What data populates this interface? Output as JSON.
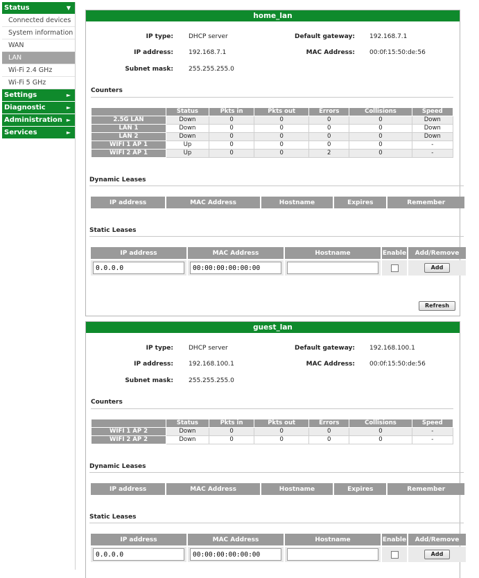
{
  "sidebar": {
    "groups": [
      {
        "label": "Status",
        "arrow": "▼",
        "items": [
          "Connected devices",
          "System information",
          "WAN",
          "LAN",
          "Wi-Fi 2.4 GHz",
          "Wi-Fi 5 GHz"
        ]
      },
      {
        "label": "Settings",
        "arrow": "►"
      },
      {
        "label": "Diagnostic",
        "arrow": "►"
      },
      {
        "label": "Administration",
        "arrow": "►"
      },
      {
        "label": "Services",
        "arrow": "►"
      }
    ],
    "active_item": "LAN"
  },
  "labels": {
    "ip_type": "IP type:",
    "ip_address": "IP address:",
    "subnet_mask": "Subnet mask:",
    "default_gateway": "Default gateway:",
    "mac_address": "MAC Address:",
    "counters": "Counters",
    "dynamic_leases": "Dynamic Leases",
    "static_leases": "Static Leases",
    "refresh": "Refresh",
    "add": "Add"
  },
  "counter_headers": [
    "Status",
    "Pkts in",
    "Pkts out",
    "Errors",
    "Collisions",
    "Speed"
  ],
  "dynamic_headers": [
    "IP address",
    "MAC Address",
    "Hostname",
    "Expires",
    "Remember"
  ],
  "static_headers": [
    "IP address",
    "MAC Address",
    "Hostname",
    "Enable",
    "Add/Remove"
  ],
  "panels": [
    {
      "title": "home_lan",
      "ip_type": "DHCP server",
      "ip_address": "192.168.7.1",
      "subnet_mask": "255.255.255.0",
      "default_gateway": "192.168.7.1",
      "mac_address": "00:0f:15:50:de:56",
      "counters": [
        [
          "2.5G LAN",
          "Down",
          "0",
          "0",
          "0",
          "0",
          "Down"
        ],
        [
          "LAN 1",
          "Down",
          "0",
          "0",
          "0",
          "0",
          "Down"
        ],
        [
          "LAN 2",
          "Down",
          "0",
          "0",
          "0",
          "0",
          "Down"
        ],
        [
          "WIFI 1 AP 1",
          "Up",
          "0",
          "0",
          "0",
          "0",
          "-"
        ],
        [
          "WIFI 2 AP 1",
          "Up",
          "0",
          "0",
          "2",
          "0",
          "-"
        ]
      ],
      "static_ip": "0.0.0.0",
      "static_mac": "00:00:00:00:00:00",
      "static_hostname": ""
    },
    {
      "title": "guest_lan",
      "ip_type": "DHCP server",
      "ip_address": "192.168.100.1",
      "subnet_mask": "255.255.255.0",
      "default_gateway": "192.168.100.1",
      "mac_address": "00:0f:15:50:de:56",
      "counters": [
        [
          "WIFI 1 AP 2",
          "Down",
          "0",
          "0",
          "0",
          "0",
          "-"
        ],
        [
          "WIFI 2 AP 2",
          "Down",
          "0",
          "0",
          "0",
          "0",
          "-"
        ]
      ],
      "static_ip": "0.0.0.0",
      "static_mac": "00:00:00:00:00:00",
      "static_hostname": ""
    }
  ]
}
